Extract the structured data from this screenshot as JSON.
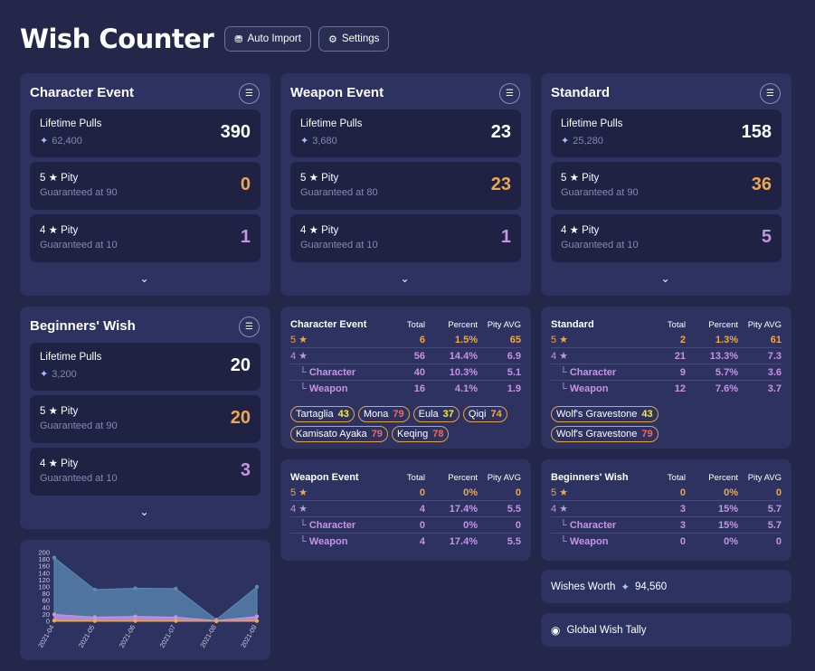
{
  "header": {
    "title": "Wish Counter",
    "auto_import": "Auto Import",
    "settings": "Settings"
  },
  "cards": {
    "character": {
      "title": "Character Event",
      "lifetime_label": "Lifetime Pulls",
      "lifetime_sub": "62,400",
      "lifetime_val": "390",
      "p5_label": "5 ★ Pity",
      "p5_sub": "Guaranteed at 90",
      "p5_val": "0",
      "p4_label": "4 ★ Pity",
      "p4_sub": "Guaranteed at 10",
      "p4_val": "1"
    },
    "weapon": {
      "title": "Weapon Event",
      "lifetime_label": "Lifetime Pulls",
      "lifetime_sub": "3,680",
      "lifetime_val": "23",
      "p5_label": "5 ★ Pity",
      "p5_sub": "Guaranteed at 80",
      "p5_val": "23",
      "p4_label": "4 ★ Pity",
      "p4_sub": "Guaranteed at 10",
      "p4_val": "1"
    },
    "standard": {
      "title": "Standard",
      "lifetime_label": "Lifetime Pulls",
      "lifetime_sub": "25,280",
      "lifetime_val": "158",
      "p5_label": "5 ★ Pity",
      "p5_sub": "Guaranteed at 90",
      "p5_val": "36",
      "p4_label": "4 ★ Pity",
      "p4_sub": "Guaranteed at 10",
      "p4_val": "5"
    },
    "beginners": {
      "title": "Beginners' Wish",
      "lifetime_label": "Lifetime Pulls",
      "lifetime_sub": "3,200",
      "lifetime_val": "20",
      "p5_label": "5 ★ Pity",
      "p5_sub": "Guaranteed at 90",
      "p5_val": "20",
      "p4_label": "4 ★ Pity",
      "p4_sub": "Guaranteed at 10",
      "p4_val": "3"
    }
  },
  "table_headers": {
    "total": "Total",
    "percent": "Percent",
    "pity": "Pity AVG"
  },
  "tables": {
    "character": {
      "title": "Character Event",
      "rows": [
        {
          "label": "5 ★",
          "total": "6",
          "percent": "1.5%",
          "pity": "65"
        },
        {
          "label": "4 ★",
          "total": "56",
          "percent": "14.4%",
          "pity": "6.9"
        },
        {
          "label": "└ Character",
          "total": "40",
          "percent": "10.3%",
          "pity": "5.1"
        },
        {
          "label": "└ Weapon",
          "total": "16",
          "percent": "4.1%",
          "pity": "1.9"
        }
      ],
      "chips": [
        {
          "name": "Tartaglia",
          "n": "43"
        },
        {
          "name": "Mona",
          "n": "79"
        },
        {
          "name": "Eula",
          "n": "37"
        },
        {
          "name": "Qiqi",
          "n": "74"
        },
        {
          "name": "Kamisato Ayaka",
          "n": "79"
        },
        {
          "name": "Keqing",
          "n": "78"
        }
      ]
    },
    "standard": {
      "title": "Standard",
      "rows": [
        {
          "label": "5 ★",
          "total": "2",
          "percent": "1.3%",
          "pity": "61"
        },
        {
          "label": "4 ★",
          "total": "21",
          "percent": "13.3%",
          "pity": "7.3"
        },
        {
          "label": "└ Character",
          "total": "9",
          "percent": "5.7%",
          "pity": "3.6"
        },
        {
          "label": "└ Weapon",
          "total": "12",
          "percent": "7.6%",
          "pity": "3.7"
        }
      ],
      "chips": [
        {
          "name": "Wolf's Gravestone",
          "n": "43"
        },
        {
          "name": "Wolf's Gravestone",
          "n": "79"
        }
      ]
    },
    "weapon": {
      "title": "Weapon Event",
      "rows": [
        {
          "label": "5 ★",
          "total": "0",
          "percent": "0%",
          "pity": "0"
        },
        {
          "label": "4 ★",
          "total": "4",
          "percent": "17.4%",
          "pity": "5.5"
        },
        {
          "label": "└ Character",
          "total": "0",
          "percent": "0%",
          "pity": "0"
        },
        {
          "label": "└ Weapon",
          "total": "4",
          "percent": "17.4%",
          "pity": "5.5"
        }
      ]
    },
    "beginners": {
      "title": "Beginners' Wish",
      "rows": [
        {
          "label": "5 ★",
          "total": "0",
          "percent": "0%",
          "pity": "0"
        },
        {
          "label": "4 ★",
          "total": "3",
          "percent": "15%",
          "pity": "5.7"
        },
        {
          "label": "└ Character",
          "total": "3",
          "percent": "15%",
          "pity": "5.7"
        },
        {
          "label": "└ Weapon",
          "total": "0",
          "percent": "0%",
          "pity": "0"
        }
      ]
    }
  },
  "wishes_worth": {
    "label": "Wishes Worth",
    "value": "94,560"
  },
  "global_tally": {
    "label": "Global Wish Tally"
  },
  "chart_data": {
    "type": "area",
    "x": [
      "2021-04",
      "2021-05",
      "2021-06",
      "2021-07",
      "2021-08",
      "2021-09"
    ],
    "y_ticks": [
      "200",
      "180",
      "160",
      "140",
      "120",
      "100",
      "80",
      "60",
      "40",
      "20",
      "0"
    ],
    "ylim": [
      0,
      200
    ],
    "series": [
      {
        "values": [
          185,
          92,
          96,
          95,
          5,
          100
        ],
        "color": "#5b8bb5"
      },
      {
        "values": [
          20,
          12,
          14,
          12,
          2,
          14
        ],
        "color": "#c693e5"
      },
      {
        "values": [
          2,
          1,
          1,
          1,
          0,
          1
        ],
        "color": "#f0a64a"
      }
    ]
  }
}
